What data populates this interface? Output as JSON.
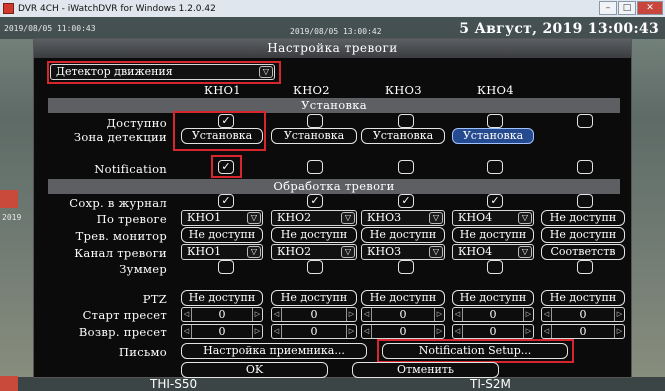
{
  "window": {
    "title": "DVR 4CH - iWatchDVR for Windows 1.2.0.42"
  },
  "osd": {
    "left_time": "2019/08/05 11:00:43",
    "mid_time": "2019/08/05 13:00:42",
    "date_time": "5 Август, 2019 13:00:43",
    "side_time": "2019",
    "cam_left": "THI-S50",
    "cam_right": "TI-S2M"
  },
  "dialog": {
    "title": "Настройка тревоги",
    "detector_select": "Детектор движения",
    "channels": [
      "КНО1",
      "КНО2",
      "КНО3",
      "КНО4"
    ],
    "setup_section": "Установка",
    "rows": {
      "available": "Доступно",
      "zone": "Зона детекции",
      "notification": "Notification"
    },
    "zone_button": "Установка",
    "alarm_section": "Обработка тревоги",
    "alarm_rows": {
      "log": "Сохр. в журнал",
      "by_alarm": "По тревоге",
      "monitor": "Трев. монитор",
      "channel": "Канал тревоги",
      "buzzer": "Зуммер",
      "ptz": "PTZ",
      "start_preset": "Старт пресет",
      "return_preset": "Возвр. пресет",
      "mail": "Письмо"
    },
    "na": "Не доступн",
    "match": "Соответств",
    "preset_value": "0",
    "mail_setup": "Настройка приемника...",
    "notification_setup": "Notification Setup...",
    "ok": "OK",
    "cancel": "Отменить",
    "check_glyph": "✓"
  }
}
